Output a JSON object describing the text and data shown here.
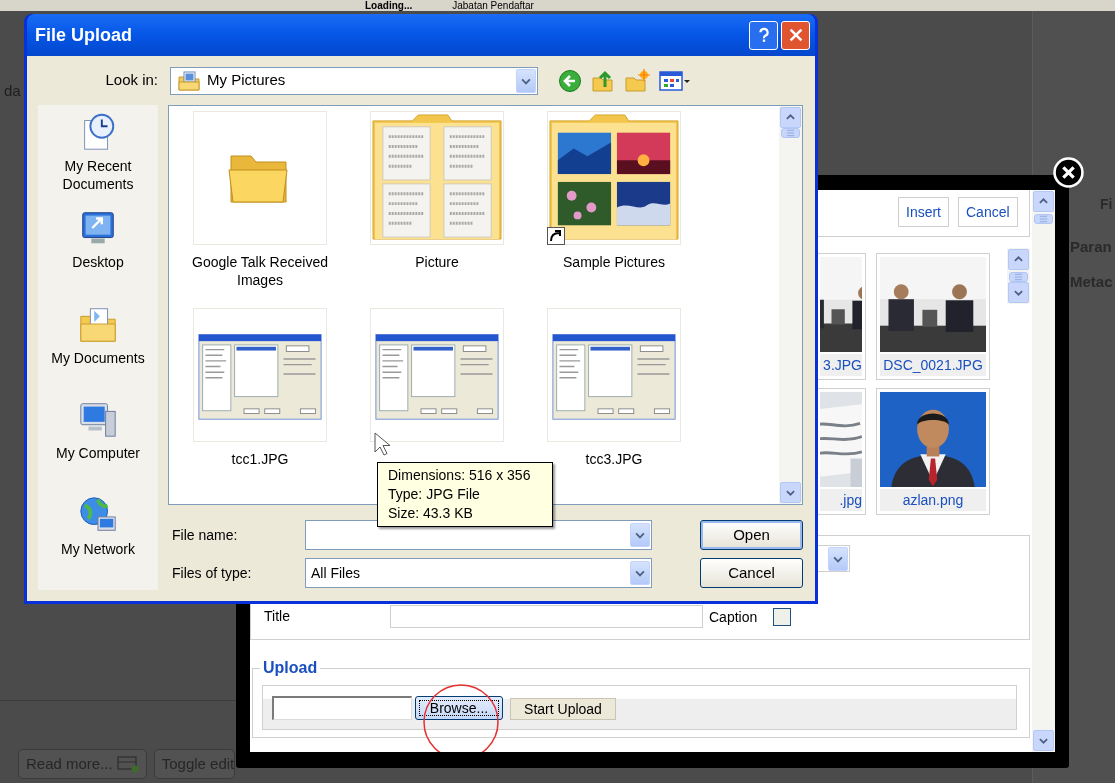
{
  "background_page": {
    "top_tabs": [
      "Loading...",
      "Jabatan Pendaftar"
    ],
    "side_text": "da",
    "right_labels": [
      "Fi",
      "Paran",
      "Metac"
    ],
    "buttons": [
      {
        "label": "Read more...",
        "kind": "readmore"
      },
      {
        "label": "Toggle edit",
        "kind": "plain"
      }
    ]
  },
  "image_manager": {
    "buttons": [
      "Insert",
      "Cancel"
    ],
    "images": [
      {
        "name": "3.JPG",
        "kind": "meeting"
      },
      {
        "name": "DSC_0021.JPG",
        "kind": "meeting"
      },
      {
        "name": ".jpg",
        "kind": "document"
      },
      {
        "name": "azlan.png",
        "kind": "portrait"
      }
    ],
    "title_label": "Title",
    "caption_label": "Caption",
    "caption_checked": false,
    "upload_legend": "Upload",
    "browse_button": "Browse...",
    "upload_button": "Start Upload"
  },
  "file_dialog": {
    "title": "File Upload",
    "look_in_label": "Look in:",
    "look_in_value": "My Pictures",
    "places": [
      {
        "label": "My Recent Documents",
        "kind": "recent"
      },
      {
        "label": "Desktop",
        "kind": "desktop"
      },
      {
        "label": "My Documents",
        "kind": "documents"
      },
      {
        "label": "My Computer",
        "kind": "computer"
      },
      {
        "label": "My Network",
        "kind": "network"
      }
    ],
    "items": [
      {
        "name": "Google Talk Received Images",
        "kind": "folder",
        "shortcut": false
      },
      {
        "name": "Picture",
        "kind": "document-folder",
        "shortcut": false
      },
      {
        "name": "Sample Pictures",
        "kind": "photo-folder",
        "shortcut": true
      },
      {
        "name": "tcc1.JPG",
        "kind": "screenshot",
        "shortcut": false
      },
      {
        "kind": "screenshot",
        "shortcut": false
      },
      {
        "name": "tcc3.JPG",
        "kind": "screenshot",
        "shortcut": false
      }
    ],
    "tooltip": [
      "Dimensions: 516 x 356",
      "Type: JPG File",
      "Size: 43.3 KB"
    ],
    "file_name_label": "File name:",
    "file_type_label": "Files of type:",
    "file_type_value": "All Files",
    "buttons": [
      "Open",
      "Cancel"
    ]
  }
}
